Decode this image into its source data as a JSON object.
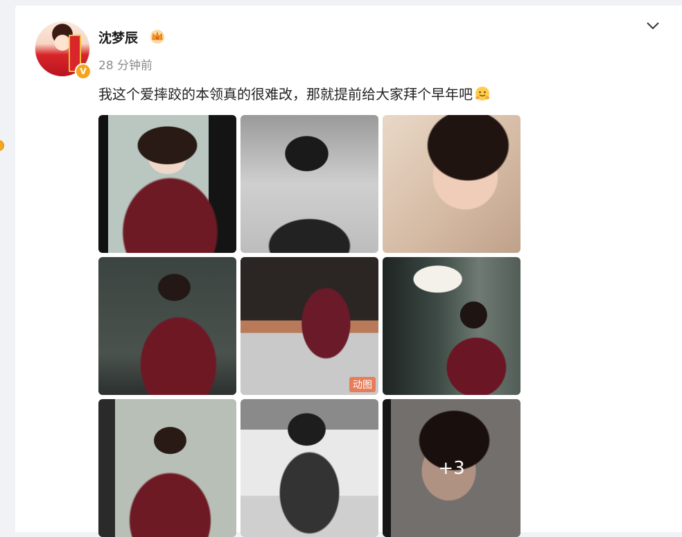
{
  "post": {
    "username": "沈梦辰",
    "timestamp": "28 分钟前",
    "text": "我这个爱摔跤的本领真的很难改，那就提前给大家拜个早年吧",
    "verified_badge": "V",
    "emoji": "hug-emoji"
  },
  "images": [
    {
      "name": "photo-1"
    },
    {
      "name": "photo-2"
    },
    {
      "name": "photo-3"
    },
    {
      "name": "photo-4"
    },
    {
      "name": "photo-5",
      "badge": "动图"
    },
    {
      "name": "photo-6"
    },
    {
      "name": "photo-7"
    },
    {
      "name": "photo-8"
    },
    {
      "name": "photo-9",
      "more_count": "+3"
    }
  ],
  "colors": {
    "accent": "#f7a41c",
    "text": "#222222",
    "muted": "#8b8b8b"
  }
}
